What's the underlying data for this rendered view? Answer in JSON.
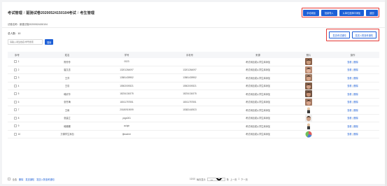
{
  "header": {
    "breadcrumb": [
      "考试管理",
      "驱驰试卷20200524150104考试",
      "考生管理"
    ],
    "separator": "/",
    "actions": [
      {
        "label": "手动添加"
      },
      {
        "label": "批量导入"
      },
      {
        "label": "从单位选择中添加"
      },
      {
        "label": "返回"
      }
    ]
  },
  "subtitle": "试卷名称：新建试卷20200524150104",
  "count": {
    "label": "总人数：",
    "value": "10"
  },
  "search": {
    "placeholder": "请输入考生姓名/学号搜索",
    "button": "搜索"
  },
  "right_actions": [
    {
      "label": "发送考试通知"
    },
    {
      "label": "发送入院准考通知"
    }
  ],
  "table": {
    "columns": [
      "序号",
      "姓名",
      "学号",
      "手机号",
      "来源",
      "照片",
      "操作"
    ],
    "op_labels": {
      "edit": "查看",
      "delete": "删除",
      "sep": "|"
    },
    "rows": [
      {
        "no": "1",
        "name": "陈伶伶",
        "id": "0023",
        "phone": "",
        "source": "考试添加或从学生库添加",
        "photo": {
          "kind": "face",
          "skin": "#c99a7c",
          "bg": "#8a6048"
        }
      },
      {
        "no": "2",
        "name": "崔文念",
        "id": "13201264097",
        "phone": "13201264097",
        "source": "考试添加或从学生库添加",
        "photo": {
          "kind": "face",
          "skin": "#e0b29a",
          "bg": "#b88b73"
        }
      },
      {
        "no": "3",
        "name": "王洋",
        "id": "13581439952",
        "phone": "13581439952",
        "source": "考试添加或从学生库添加",
        "photo": {
          "kind": "face",
          "skin": "#d6a488",
          "bg": "#9f7a62"
        }
      },
      {
        "no": "4",
        "name": "王欢",
        "id": "15502009321",
        "phone": "15502009321",
        "source": "考试添加或从学生库添加",
        "photo": {
          "kind": "face",
          "skin": "#cf9f86",
          "bg": "#7d5a44"
        }
      },
      {
        "no": "5",
        "name": "韩欣华",
        "id": "18234134375",
        "phone": "18234134375",
        "source": "考试添加或从学生库添加",
        "photo": {
          "kind": "face",
          "skin": "#c89376",
          "bg": "#6f5241"
        }
      },
      {
        "no": "6",
        "name": "张冬梅",
        "id": "18011757551",
        "phone": "18011757551",
        "source": "考试添加或从学生库添加",
        "photo": {
          "kind": "face",
          "skin": "#d8a48b",
          "bg": "#a47a63"
        }
      },
      {
        "no": "7",
        "name": "王雨",
        "id": "20180919099",
        "phone": "15382440923",
        "source": "考试添加或从学生库添加",
        "photo": {
          "kind": "figure",
          "skin": "#e8c9a8",
          "bg": "#ffffff"
        }
      },
      {
        "no": "8",
        "name": "张建立",
        "id": "yxgs001",
        "phone": "",
        "source": "考试添加或从学生库添加",
        "photo": {
          "kind": "face",
          "skin": "#cfa48a",
          "bg": "#f0f0f0"
        }
      },
      {
        "no": "9",
        "name": "韩姗姗",
        "id": "cuiqin",
        "phone": "",
        "source": "考试添加或从学生库添加",
        "photo": {
          "kind": "figure",
          "skin": "#e4c2a0",
          "bg": "#ffffff"
        }
      },
      {
        "no": "10",
        "name": "万课学生添加",
        "id": "tjteacher",
        "phone": "",
        "source": "考试添加或从学生库添加",
        "photo": {
          "kind": "pie",
          "skin": "#6fbf5a",
          "bg": "#ffffff"
        }
      }
    ]
  },
  "footer": {
    "select_all": "全选",
    "delete": "删除",
    "notify": "发送通知",
    "notify_admit": "发送入院准考通知",
    "total": "10/10",
    "per_page_label": "每页显示",
    "per_page": "10",
    "per_page_unit": "条",
    "prev": "上一页",
    "page": "1",
    "next": "下一页"
  }
}
